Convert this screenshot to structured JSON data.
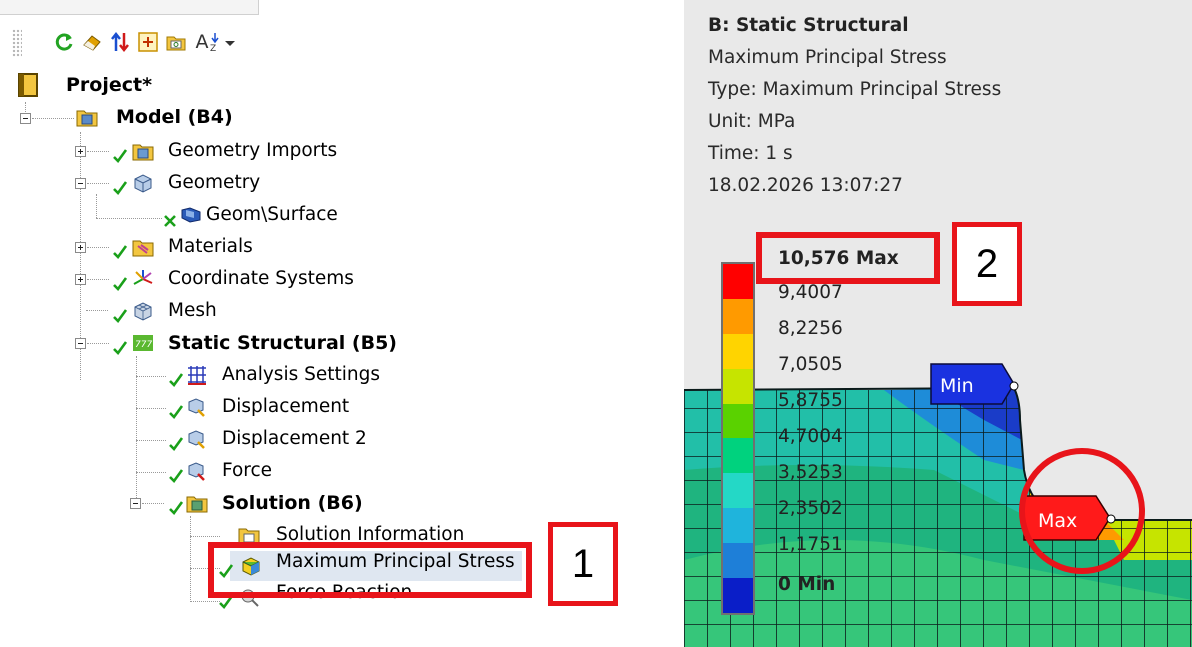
{
  "toolbar": {
    "items": [
      "refresh-icon",
      "eraser-icon",
      "sort-arrows-icon",
      "expand-all-icon",
      "collapse-folder-icon",
      "sort-az-icon",
      "dropdown-arrow-icon"
    ],
    "sort_label": "A"
  },
  "tree": {
    "project": "Project*",
    "model": "Model (B4)",
    "geometry_imports": "Geometry Imports",
    "geometry": "Geometry",
    "geom_surface": "Geom\\Surface",
    "materials": "Materials",
    "coordinate_systems": "Coordinate Systems",
    "mesh": "Mesh",
    "static_structural": "Static Structural (B5)",
    "analysis_settings": "Analysis Settings",
    "displacement": "Displacement",
    "displacement_2": "Displacement 2",
    "force": "Force",
    "solution": "Solution (B6)",
    "solution_information": "Solution Information",
    "max_principal_stress": "Maximum Principal Stress",
    "force_reaction": "Force Reaction"
  },
  "result": {
    "title": "B: Static Structural",
    "name": "Maximum Principal Stress",
    "type": "Type: Maximum Principal Stress",
    "unit": "Unit: MPa",
    "time": "Time: 1 s",
    "timestamp": "18.02.2026 13:07:27"
  },
  "legend": {
    "values": [
      "10,576 Max",
      "9,4007",
      "8,2256",
      "7,0505",
      "5,8755",
      "4,7004",
      "3,5253",
      "2,3502",
      "1,1751",
      "0 Min"
    ],
    "colors": [
      "#ff0000",
      "#ff9a00",
      "#ffd400",
      "#c6e400",
      "#5ad200",
      "#00d27e",
      "#24d8c6",
      "#1fb4dc",
      "#1e7fd8",
      "#0a1ec8"
    ]
  },
  "probes": {
    "min_label": "Min",
    "max_label": "Max"
  },
  "annotations": {
    "one": "1",
    "two": "2"
  },
  "colors": {
    "annotation_red": "#e8141a",
    "check_green": "#1aa01a",
    "selection_bg": "#dfe7f1"
  }
}
